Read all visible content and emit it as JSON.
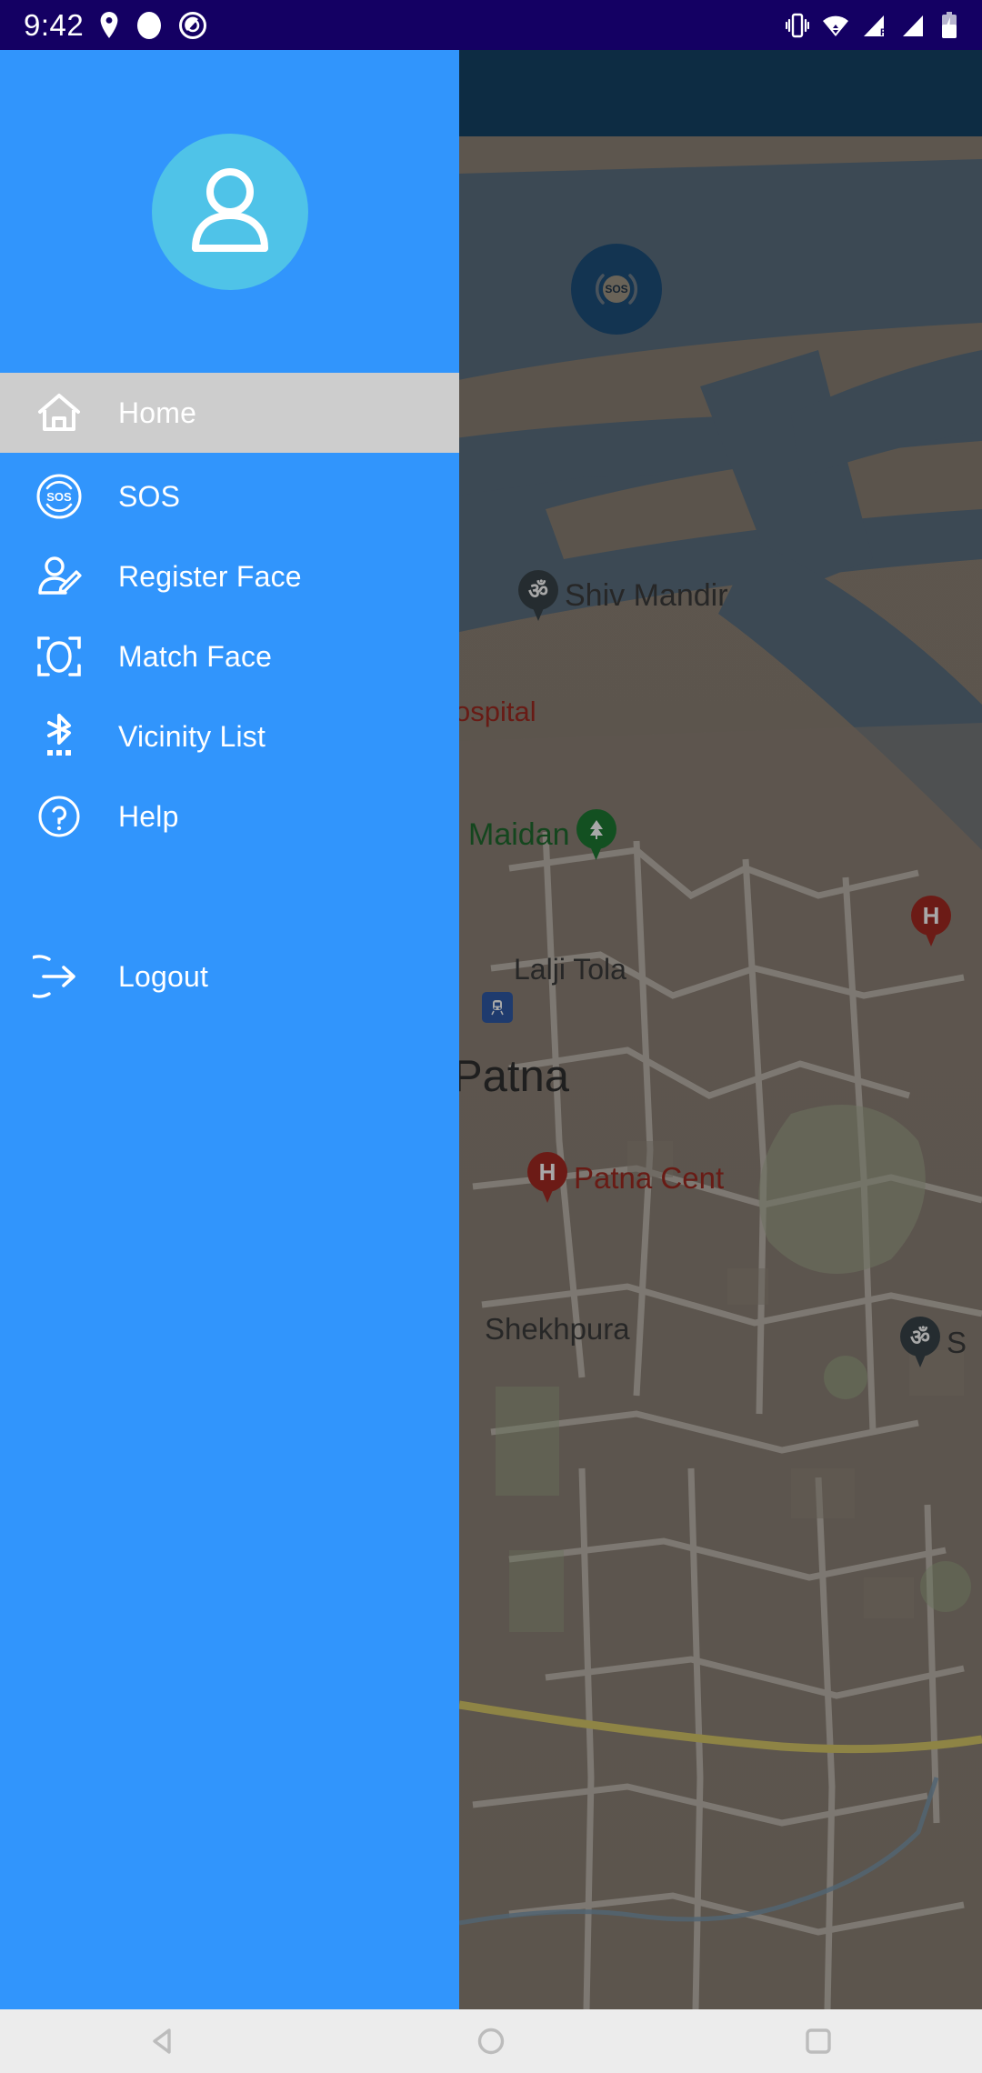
{
  "status_bar": {
    "time": "9:42",
    "background": "#140063",
    "left_icons": [
      "location-pin-icon",
      "circle-dot-icon",
      "capture-icon"
    ],
    "right_icons": [
      "vibrate-icon",
      "wifi-icon",
      "signal-r-icon",
      "signal-icon",
      "battery-charging-icon"
    ]
  },
  "drawer": {
    "background": "#3195fc",
    "avatar": {
      "icon": "person-avatar-icon",
      "circle_color": "#4fc3e8"
    },
    "active_item_background": "#cdcdcd",
    "items": [
      {
        "id": "home",
        "label": "Home",
        "icon": "home-icon",
        "active": true
      },
      {
        "id": "sos",
        "label": "SOS",
        "icon": "sos-icon",
        "active": false
      },
      {
        "id": "register-face",
        "label": "Register Face",
        "icon": "person-edit-icon",
        "active": false
      },
      {
        "id": "match-face",
        "label": "Match Face",
        "icon": "face-scan-icon",
        "active": false
      },
      {
        "id": "vicinity-list",
        "label": "Vicinity List",
        "icon": "bluetooth-icon",
        "active": false
      },
      {
        "id": "help",
        "label": "Help",
        "icon": "question-mark-icon",
        "active": false
      }
    ],
    "logout": {
      "id": "logout",
      "label": "Logout",
      "icon": "logout-arrow-icon"
    }
  },
  "map": {
    "sos_button": {
      "label": "SOS",
      "icon": "sos-broadcast-icon",
      "color": "#1d4f7c"
    },
    "labels": [
      {
        "id": "shiv-mandir",
        "text": "Shiv Mandir",
        "marker": "om-temple-pin",
        "color": "#3c3c3c"
      },
      {
        "id": "hospital",
        "text": "ospital",
        "marker": "none",
        "color": "#9e2a21"
      },
      {
        "id": "gandhi-maidan",
        "text": "i Maidan",
        "marker": "park-tree-pin",
        "color": "#1f6b2e"
      },
      {
        "id": "lalji-tola",
        "text": "Lalji Tola",
        "marker": "none",
        "color": "#3c3c3c"
      },
      {
        "id": "patna",
        "text": "Patna",
        "marker": "none",
        "color": "#2f2f2f"
      },
      {
        "id": "patna-central",
        "text": "Patna Cent",
        "marker": "hospital-h-pin",
        "color": "#9e2a21"
      },
      {
        "id": "shekhpura",
        "text": "Shekhpura",
        "marker": "none",
        "color": "#3c3c3c"
      },
      {
        "id": "hospital-2",
        "text": "",
        "marker": "hospital-h-pin",
        "color": "#9e2a21"
      },
      {
        "id": "temple-2",
        "text": "S",
        "marker": "om-temple-pin",
        "color": "#3c3c3c"
      },
      {
        "id": "station",
        "text": "",
        "marker": "train-station-icon",
        "color": "#2f5aa8"
      }
    ]
  },
  "nav_bar": {
    "background": "#ececec",
    "buttons": [
      {
        "id": "back",
        "icon": "triangle-back-icon"
      },
      {
        "id": "home",
        "icon": "circle-home-icon"
      },
      {
        "id": "recents",
        "icon": "square-recents-icon"
      }
    ]
  }
}
